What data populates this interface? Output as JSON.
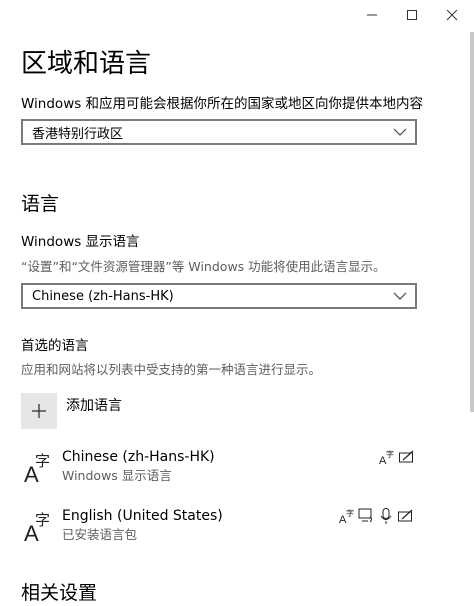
{
  "window": {
    "controls": [
      "minimize-icon",
      "maximize-icon",
      "close-icon"
    ]
  },
  "page": {
    "title": "区域和语言",
    "region_label": "Windows 和应用可能会根据你所在的国家或地区向你提供本地内容",
    "region_value": "香港特别行政区"
  },
  "language": {
    "section_title": "语言",
    "display_label": "Windows 显示语言",
    "display_desc": "“设置”和“文件资源管理器”等 Windows 功能将使用此语言显示。",
    "display_value": "Chinese (zh-Hans-HK)",
    "preferred_title": "首选的语言",
    "preferred_desc": "应用和网站将以列表中受支持的第一种语言进行显示。",
    "add_label": "添加语言",
    "items": [
      {
        "name": "Chinese (zh-Hans-HK)",
        "status": "Windows 显示语言",
        "features": [
          "display-language-icon",
          "handwriting-icon"
        ]
      },
      {
        "name": "English (United States)",
        "status": "已安装语言包",
        "features": [
          "display-language-icon",
          "text-to-speech-icon",
          "speech-recognition-icon",
          "handwriting-icon"
        ]
      }
    ]
  },
  "related": {
    "section_title": "相关设置"
  },
  "colors": {
    "border": "#7a7a7a",
    "add_bg": "#e6e6e6",
    "muted_text": "#5d5d5d"
  }
}
